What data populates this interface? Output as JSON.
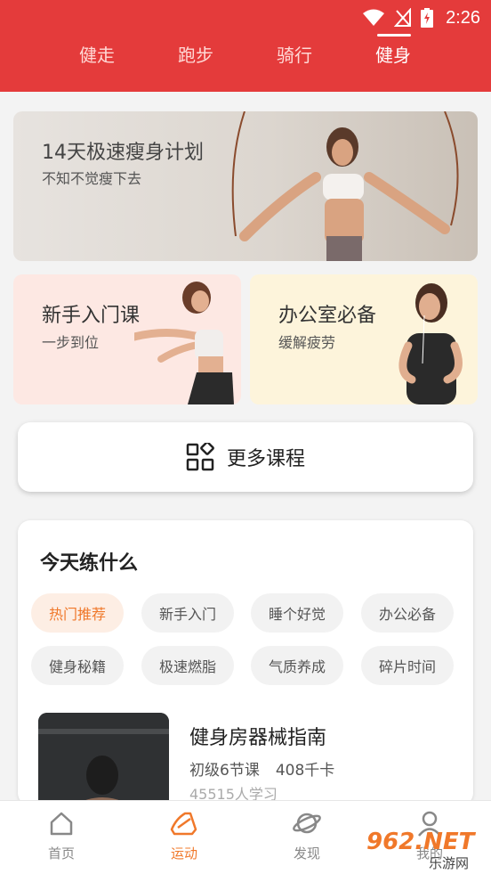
{
  "status_bar": {
    "time": "2:26"
  },
  "top_tabs": [
    {
      "label": "健走"
    },
    {
      "label": "跑步"
    },
    {
      "label": "骑行"
    },
    {
      "label": "健身",
      "active": true
    }
  ],
  "banner": {
    "title": "14天极速瘦身计划",
    "subtitle": "不知不觉瘦下去"
  },
  "cards": [
    {
      "title": "新手入门课",
      "subtitle": "一步到位"
    },
    {
      "title": "办公室必备",
      "subtitle": "缓解疲劳"
    }
  ],
  "more_courses": {
    "label": "更多课程"
  },
  "today": {
    "title": "今天练什么",
    "chips": [
      {
        "label": "热门推荐",
        "active": true
      },
      {
        "label": "新手入门"
      },
      {
        "label": "睡个好觉"
      },
      {
        "label": "办公必备"
      },
      {
        "label": "健身秘籍"
      },
      {
        "label": "极速燃脂"
      },
      {
        "label": "气质养成"
      },
      {
        "label": "碎片时间"
      }
    ],
    "course": {
      "title": "健身房器械指南",
      "level": "初级6节课",
      "calories": "408千卡",
      "learners": "45515人学习"
    }
  },
  "bottom_nav": [
    {
      "label": "首页",
      "icon": "home-icon"
    },
    {
      "label": "运动",
      "icon": "shoe-icon",
      "active": true
    },
    {
      "label": "发现",
      "icon": "planet-icon"
    },
    {
      "label": "我的",
      "icon": "user-icon"
    }
  ],
  "watermark": {
    "brand": "962.NET",
    "sub": "乐游网"
  },
  "colors": {
    "header": "#e43b3b",
    "accent": "#f0782a"
  }
}
